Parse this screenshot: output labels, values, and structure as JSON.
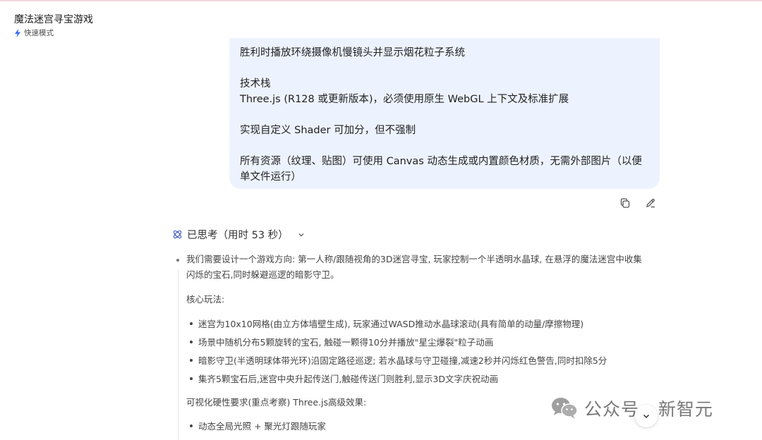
{
  "header": {
    "title": "魔法迷宫寻宝游戏",
    "mode": "快速模式"
  },
  "user_message": {
    "lines": [
      "胜利时播放环绕摄像机慢镜头并显示烟花粒子系统",
      "",
      "技术栈",
      "Three.js (R128 或更新版本)，必须使用原生 WebGL 上下文及标准扩展",
      "",
      "实现自定义 Shader 可加分，但不强制",
      "",
      "所有资源（纹理、贴图）可使用 Canvas 动态生成或内置颜色材质，无需外部图片（以便",
      "单文件运行）"
    ]
  },
  "actions": {
    "copy_icon": "copy-icon",
    "edit_icon": "edit-icon"
  },
  "thinking": {
    "label": "已思考（用时 53 秒）",
    "intro_line1": "我们需要设计一个游戏方向: 第一人称/跟随视角的3D迷宫寻宝, 玩家控制一个半透明水晶球, 在悬浮的魔法迷宫中收集",
    "intro_line2": "闪烁的宝石,同时躲避巡逻的暗影守卫。",
    "core_title": "核心玩法:",
    "core_items": [
      "迷宫为10x10网格(由立方体墙壁生成), 玩家通过WASD推动水晶球滚动(具有简单的动量/摩擦物理)",
      "场景中随机分布5颗旋转的宝石, 触碰一颗得10分并播放\"星尘爆裂\"粒子动画",
      "暗影守卫(半透明球体带光环)沿固定路径巡逻; 若水晶球与守卫碰撞,减速2秒并闪烁红色警告,同时扣除5分",
      "集齐5颗宝石后,迷宫中央升起传送门,触碰传送门则胜利,显示3D文字庆祝动画"
    ],
    "visual_title": "可视化硬性要求(重点考察) Three.js高级效果:",
    "visual_items": [
      "动态全局光照 + 聚光灯跟随玩家"
    ]
  },
  "watermark": {
    "text": "公众号 · 新智元"
  },
  "colors": {
    "bubble_bg": "#edf3fe",
    "accent_bolt": "#3b6ef5",
    "think_icon": "#4a62c9"
  }
}
